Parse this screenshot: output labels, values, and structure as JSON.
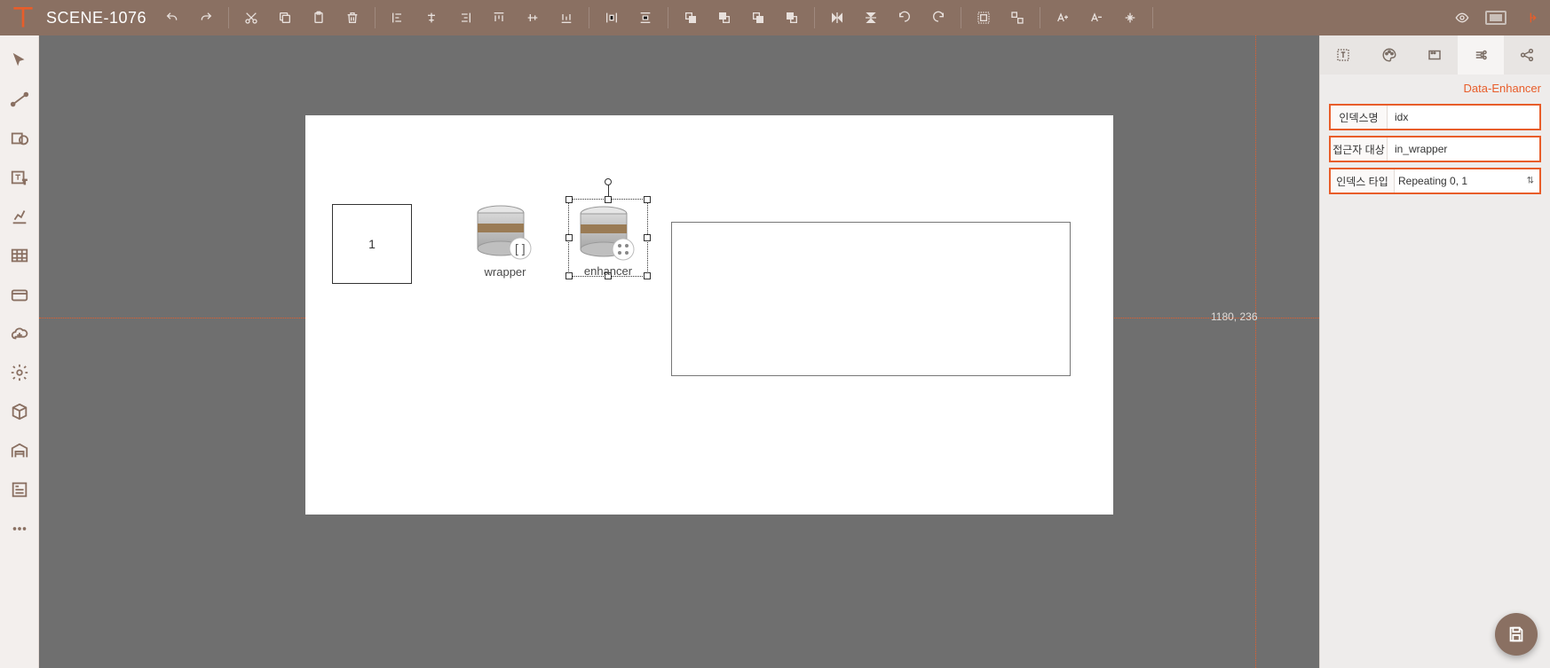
{
  "header": {
    "title": "SCENE-1076"
  },
  "canvas": {
    "box1_text": "1",
    "wrapper_label": "wrapper",
    "enhancer_label": "enhancer",
    "coord_label": "1180, 236"
  },
  "panel": {
    "title": "Data-Enhancer",
    "fields": {
      "index_name": {
        "label": "인덱스명",
        "value": "idx"
      },
      "accessor_target": {
        "label": "접근자 대상",
        "value": "in_wrapper"
      },
      "index_type": {
        "label": "인덱스 타입",
        "value": "Repeating 0, 1"
      }
    }
  }
}
